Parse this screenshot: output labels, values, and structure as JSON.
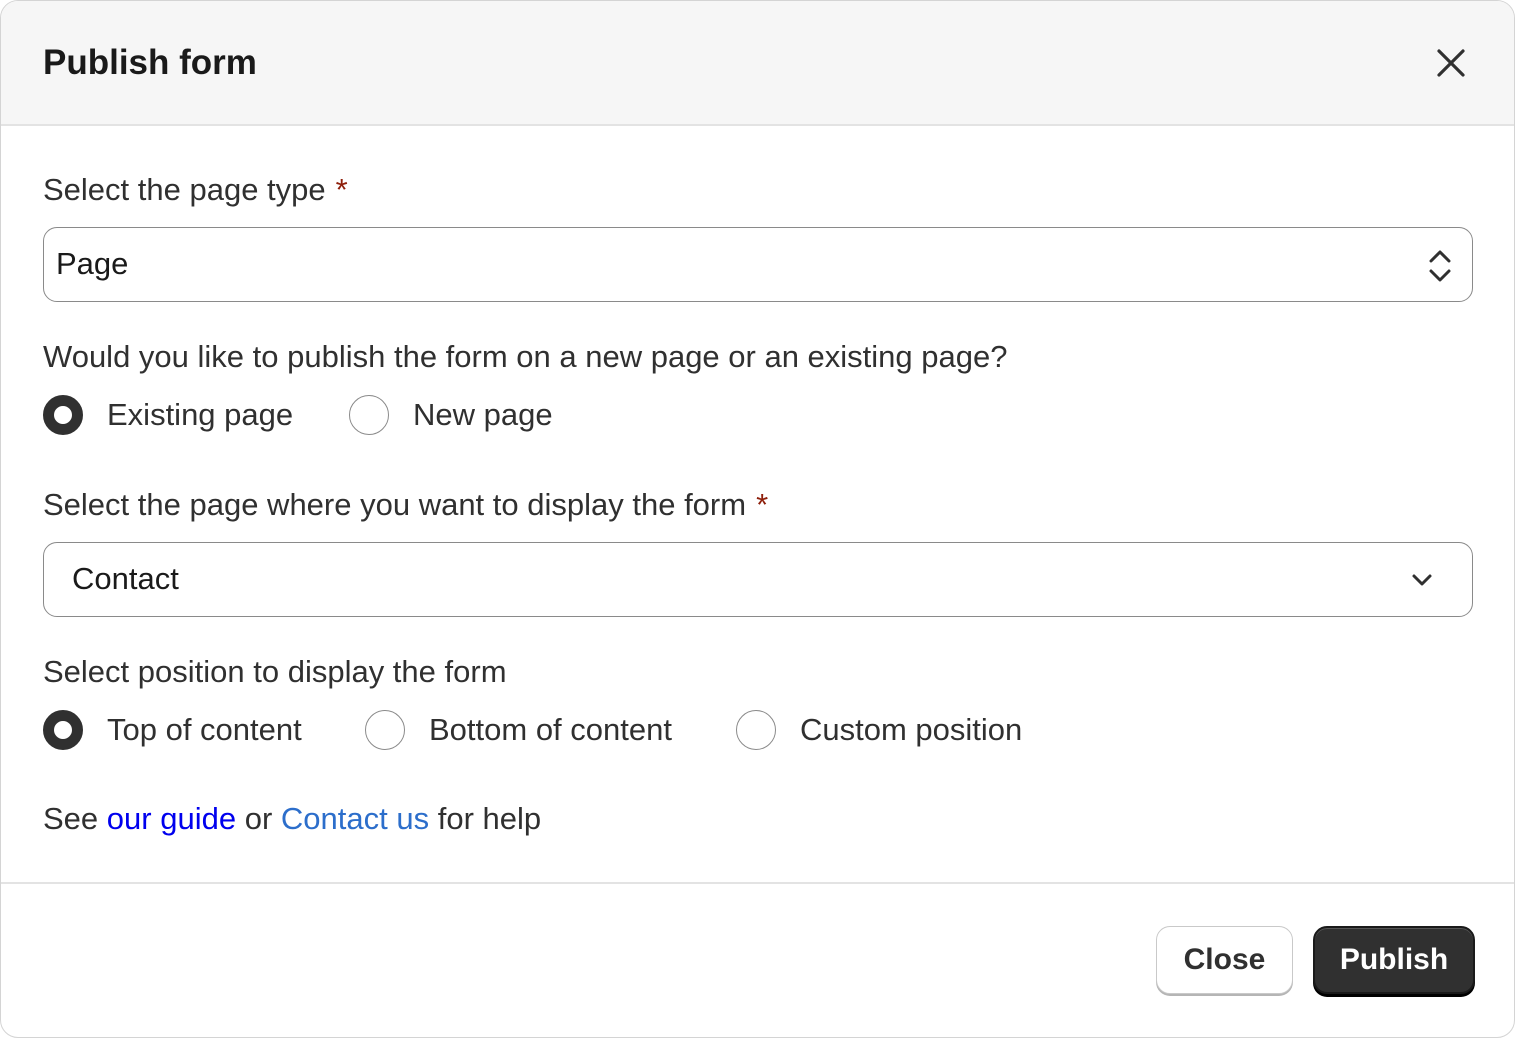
{
  "dialog": {
    "title": "Publish form",
    "close_icon": "close-icon"
  },
  "page_type": {
    "label": "Select the page type",
    "required_mark": "*",
    "value": "Page",
    "icon": "select-arrows-icon"
  },
  "publish_target": {
    "question": "Would you like to publish the form on a new page or an existing page?",
    "options": [
      {
        "label": "Existing page",
        "checked": true
      },
      {
        "label": "New page",
        "checked": false
      }
    ]
  },
  "page_select": {
    "label": "Select the page where you want to display the form",
    "required_mark": "*",
    "value": "Contact",
    "icon": "chevron-down-icon"
  },
  "position": {
    "label": "Select position to display the form",
    "options": [
      {
        "label": "Top of content",
        "checked": true
      },
      {
        "label": "Bottom of content",
        "checked": false
      },
      {
        "label": "Custom position",
        "checked": false
      }
    ]
  },
  "help": {
    "prefix": "See",
    "guide_link": "our guide",
    "middle": "or",
    "contact_link": "Contact us",
    "suffix": "for help"
  },
  "footer": {
    "close_label": "Close",
    "publish_label": "Publish"
  },
  "colors": {
    "required": "#8e1f0b",
    "guide_link": "#0000ee",
    "contact_link": "#2c6ecb",
    "primary_button": "#303030"
  }
}
